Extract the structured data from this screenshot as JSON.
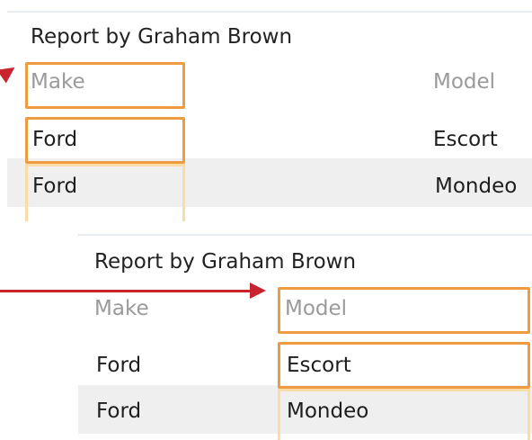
{
  "top_report": {
    "title": "Report by Graham Brown",
    "headers": {
      "make": "Make",
      "model": "Model"
    },
    "rows": [
      {
        "make": "Ford",
        "model": "Escort"
      },
      {
        "make": "Ford",
        "model": "Mondeo"
      }
    ]
  },
  "bottom_report": {
    "title": "Report by Graham Brown",
    "headers": {
      "make": "Make",
      "model": "Model"
    },
    "rows": [
      {
        "make": "Ford",
        "model": "Escort"
      },
      {
        "make": "Ford",
        "model": "Mondeo"
      }
    ]
  },
  "colors": {
    "highlight": "#ef9b3f",
    "arrow": "#c9232e",
    "row_stripe": "#efefef"
  }
}
